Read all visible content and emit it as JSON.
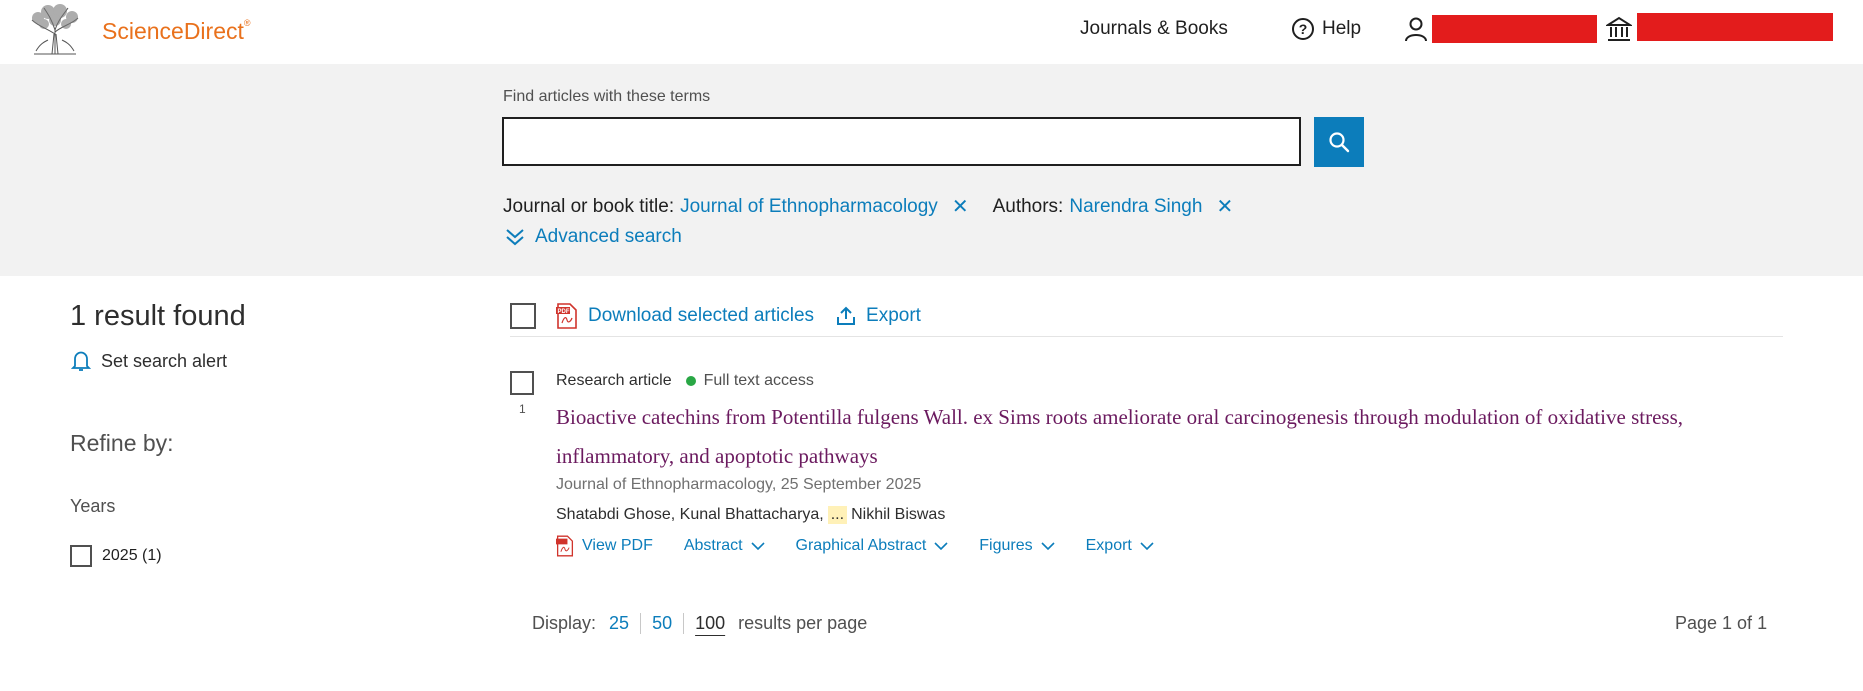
{
  "header": {
    "brand": "ScienceDirect",
    "brand_mark": "®",
    "nav_journals": "Journals & Books",
    "nav_help": "Help",
    "icons": [
      "elsevier-tree-logo",
      "help-circle-icon",
      "user-icon",
      "institution-icon"
    ],
    "redaction_color": "#e31c1c"
  },
  "search": {
    "label": "Find articles with these terms",
    "value": "",
    "placeholder": "",
    "filters": [
      {
        "label": "Journal or book title:",
        "value": "Journal of Ethnopharmacology"
      },
      {
        "label": "Authors:",
        "value": "Narendra Singh"
      }
    ],
    "advanced": "Advanced search"
  },
  "sidebar": {
    "results_count": "1 result found",
    "alert": "Set search alert",
    "refine": "Refine by:",
    "years_heading": "Years",
    "years": [
      {
        "label": "2025 (1)",
        "checked": false
      }
    ]
  },
  "toolbar": {
    "download": "Download selected articles",
    "export": "Export"
  },
  "results": [
    {
      "number": "1",
      "type": "Research article",
      "access": "Full text access",
      "title": "Bioactive catechins from Potentilla fulgens Wall. ex Sims roots ameliorate oral carcinogenesis through modulation of oxidative stress, inflammatory, and apoptotic pathways",
      "source": "Journal of Ethnopharmacology, 25 September 2025",
      "authors_first": "Shatabdi Ghose, Kunal Bhattacharya,",
      "authors_ellipsis": "...",
      "authors_last": "Nikhil Biswas",
      "actions": {
        "pdf": "View PDF",
        "abstract": "Abstract",
        "graphical": "Graphical Abstract",
        "figures": "Figures",
        "export": "Export"
      }
    }
  ],
  "pagination": {
    "display_label": "Display:",
    "options": [
      "25",
      "50",
      "100"
    ],
    "selected": "100",
    "suffix": "results per page",
    "page_text": "Page 1 of 1"
  },
  "colors": {
    "accent": "#0c7dbb",
    "brand": "#e9711c",
    "title": "#6b1a5f",
    "access": "#29a745",
    "band": "#f2f2f2"
  }
}
